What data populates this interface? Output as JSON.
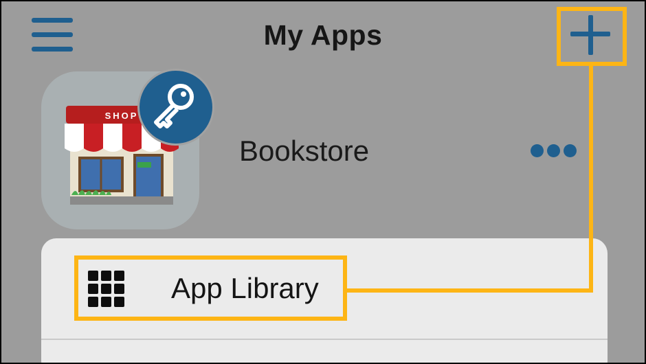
{
  "header": {
    "title": "My Apps",
    "menu_icon": "hamburger-menu-icon",
    "add_icon": "plus-icon"
  },
  "app": {
    "name": "Bookstore",
    "icon_text": "SHOP",
    "badge_icon": "key-icon",
    "more_icon": "ellipsis-icon"
  },
  "menu": {
    "items": [
      {
        "label": "App Library",
        "icon": "grid-icon"
      }
    ]
  },
  "colors": {
    "accent": "#1f5f8f",
    "highlight": "#fdb515",
    "background": "#9c9c9c",
    "sheet": "#ebebeb"
  }
}
